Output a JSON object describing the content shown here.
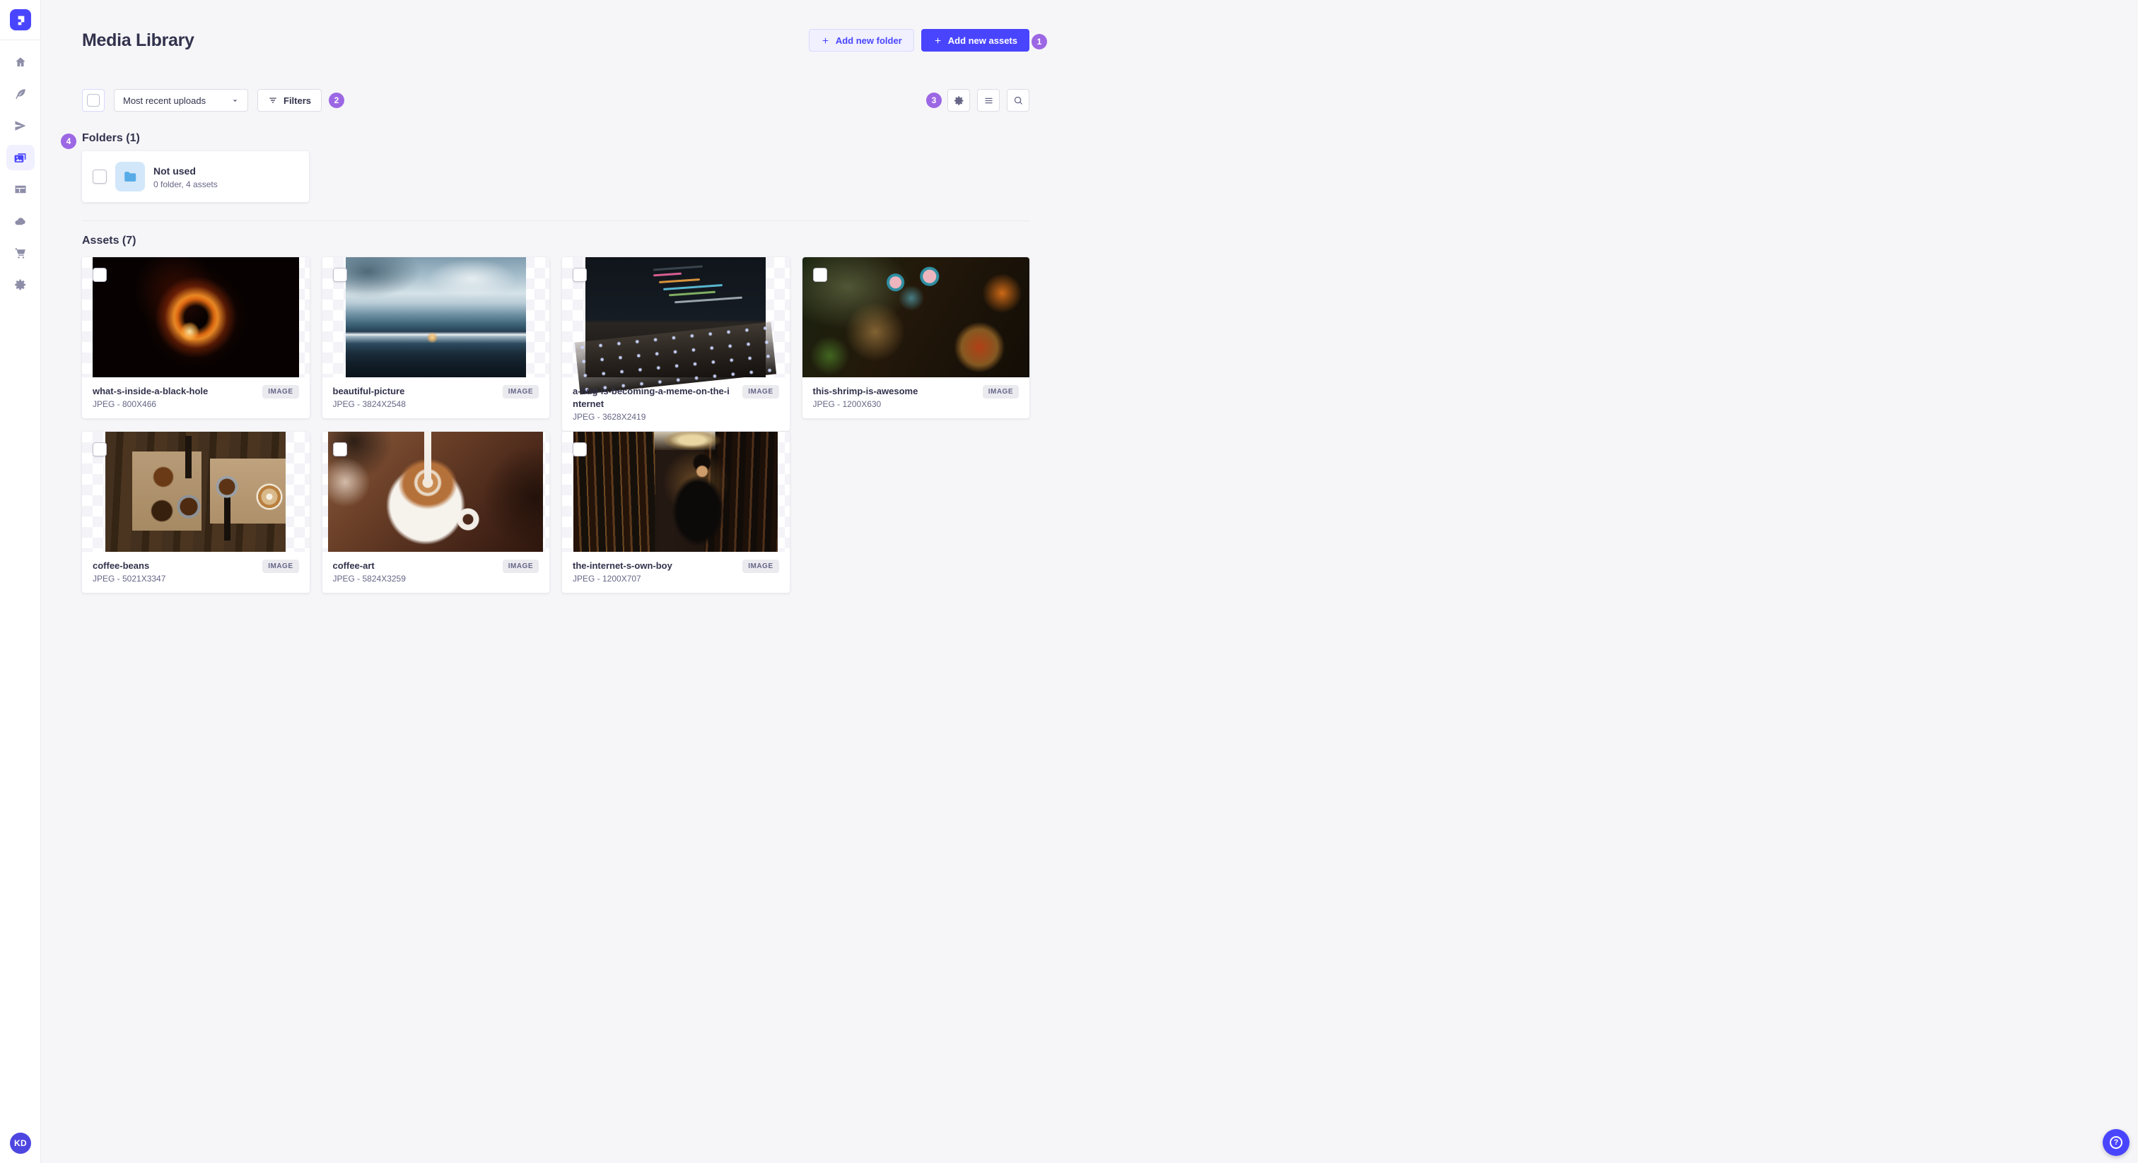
{
  "colors": {
    "primary": "#4945ff",
    "primary_light_bg": "#f0f0ff",
    "annotation_badge": "#9c67e4",
    "page_bg": "#f6f6f9",
    "text_dark": "#32324d",
    "text_muted": "#666687",
    "folder_icon_blue": "#57ace8"
  },
  "sidebar": {
    "logo_icon": "strapi-logo",
    "items": [
      {
        "icon": "home-icon",
        "active": false
      },
      {
        "icon": "feather-icon",
        "active": false
      },
      {
        "icon": "paper-plane-icon",
        "active": false
      },
      {
        "icon": "media-library-icon",
        "active": true
      },
      {
        "icon": "layout-icon",
        "active": false
      },
      {
        "icon": "cloud-icon",
        "active": false
      },
      {
        "icon": "cart-icon",
        "active": false
      },
      {
        "icon": "gear-icon",
        "active": false
      }
    ],
    "avatar_initials": "KD"
  },
  "header": {
    "title": "Media Library",
    "add_folder_label": "Add new folder",
    "add_assets_label": "Add new assets"
  },
  "toolbar": {
    "sort_value": "Most recent uploads",
    "filters_label": "Filters",
    "right_icons": [
      "gear-icon",
      "list-icon",
      "search-icon"
    ]
  },
  "annotations": {
    "badge1": "1",
    "badge2": "2",
    "badge3": "3",
    "badge4": "4"
  },
  "folders": {
    "heading": "Folders (1)",
    "items": [
      {
        "name": "Not used",
        "meta": "0 folder, 4 assets"
      }
    ]
  },
  "assets": {
    "heading": "Assets (7)",
    "items": [
      {
        "title": "what-s-inside-a-black-hole",
        "meta": "JPEG - 800X466",
        "badge": "IMAGE"
      },
      {
        "title": "beautiful-picture",
        "meta": "JPEG - 3824X2548",
        "badge": "IMAGE"
      },
      {
        "title": "a-bug-is-becoming-a-meme-on-the-internet",
        "meta": "JPEG - 3628X2419",
        "badge": "IMAGE"
      },
      {
        "title": "this-shrimp-is-awesome",
        "meta": "JPEG - 1200X630",
        "badge": "IMAGE"
      },
      {
        "title": "coffee-beans",
        "meta": "JPEG - 5021X3347",
        "badge": "IMAGE"
      },
      {
        "title": "coffee-art",
        "meta": "JPEG - 5824X3259",
        "badge": "IMAGE"
      },
      {
        "title": "the-internet-s-own-boy",
        "meta": "JPEG - 1200X707",
        "badge": "IMAGE"
      }
    ]
  },
  "help": {
    "icon": "question-mark-icon",
    "glyph": "?"
  }
}
